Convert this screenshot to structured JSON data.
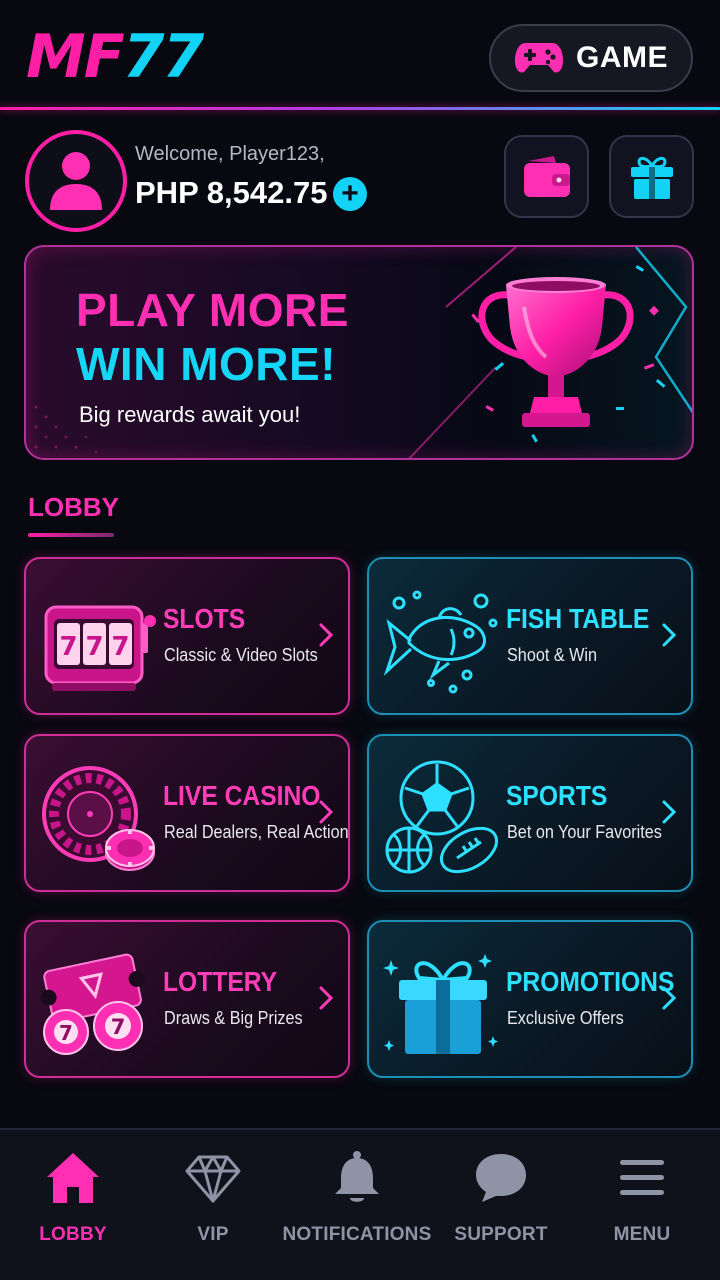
{
  "header": {
    "logo_part1": "MF",
    "logo_part2": "77",
    "game_button_label": "GAME"
  },
  "user": {
    "welcome_text": "Welcome, Player123,",
    "balance": "PHP 8,542.75",
    "add_label": "+"
  },
  "banner": {
    "line1": "PLAY MORE",
    "line2": "WIN MORE!",
    "subtitle": "Big rewards await you!"
  },
  "lobby": {
    "title": "LOBBY",
    "cards": [
      {
        "title": "SLOTS",
        "subtitle": "Classic & Video Slots",
        "theme": "pink",
        "icon": "slot-machine-icon"
      },
      {
        "title": "FISH TABLE",
        "subtitle": "Shoot & Win",
        "theme": "blue",
        "icon": "fish-icon"
      },
      {
        "title": "LIVE CASINO",
        "subtitle": "Real Dealers, Real Action",
        "theme": "pink",
        "icon": "roulette-icon"
      },
      {
        "title": "SPORTS",
        "subtitle": "Bet on Your Favorites",
        "theme": "blue",
        "icon": "sports-balls-icon"
      },
      {
        "title": "LOTTERY",
        "subtitle": "Draws & Big Prizes",
        "theme": "pink",
        "icon": "lottery-ticket-icon"
      },
      {
        "title": "PROMOTIONS",
        "subtitle": "Exclusive Offers",
        "theme": "blue",
        "icon": "gift-box-icon"
      }
    ]
  },
  "nav": {
    "items": [
      {
        "label": "LOBBY",
        "icon": "home-icon",
        "active": true
      },
      {
        "label": "VIP",
        "icon": "diamond-icon",
        "active": false
      },
      {
        "label": "NOTIFICATIONS",
        "icon": "bell-icon",
        "active": false
      },
      {
        "label": "SUPPORT",
        "icon": "chat-bubble-icon",
        "active": false
      },
      {
        "label": "MENU",
        "icon": "hamburger-menu-icon",
        "active": false
      }
    ]
  },
  "colors": {
    "background": "#070810",
    "pink_accent": "#ff1fa6",
    "cyan_accent": "#12d3f5",
    "nav_inactive": "#8f93a6"
  }
}
